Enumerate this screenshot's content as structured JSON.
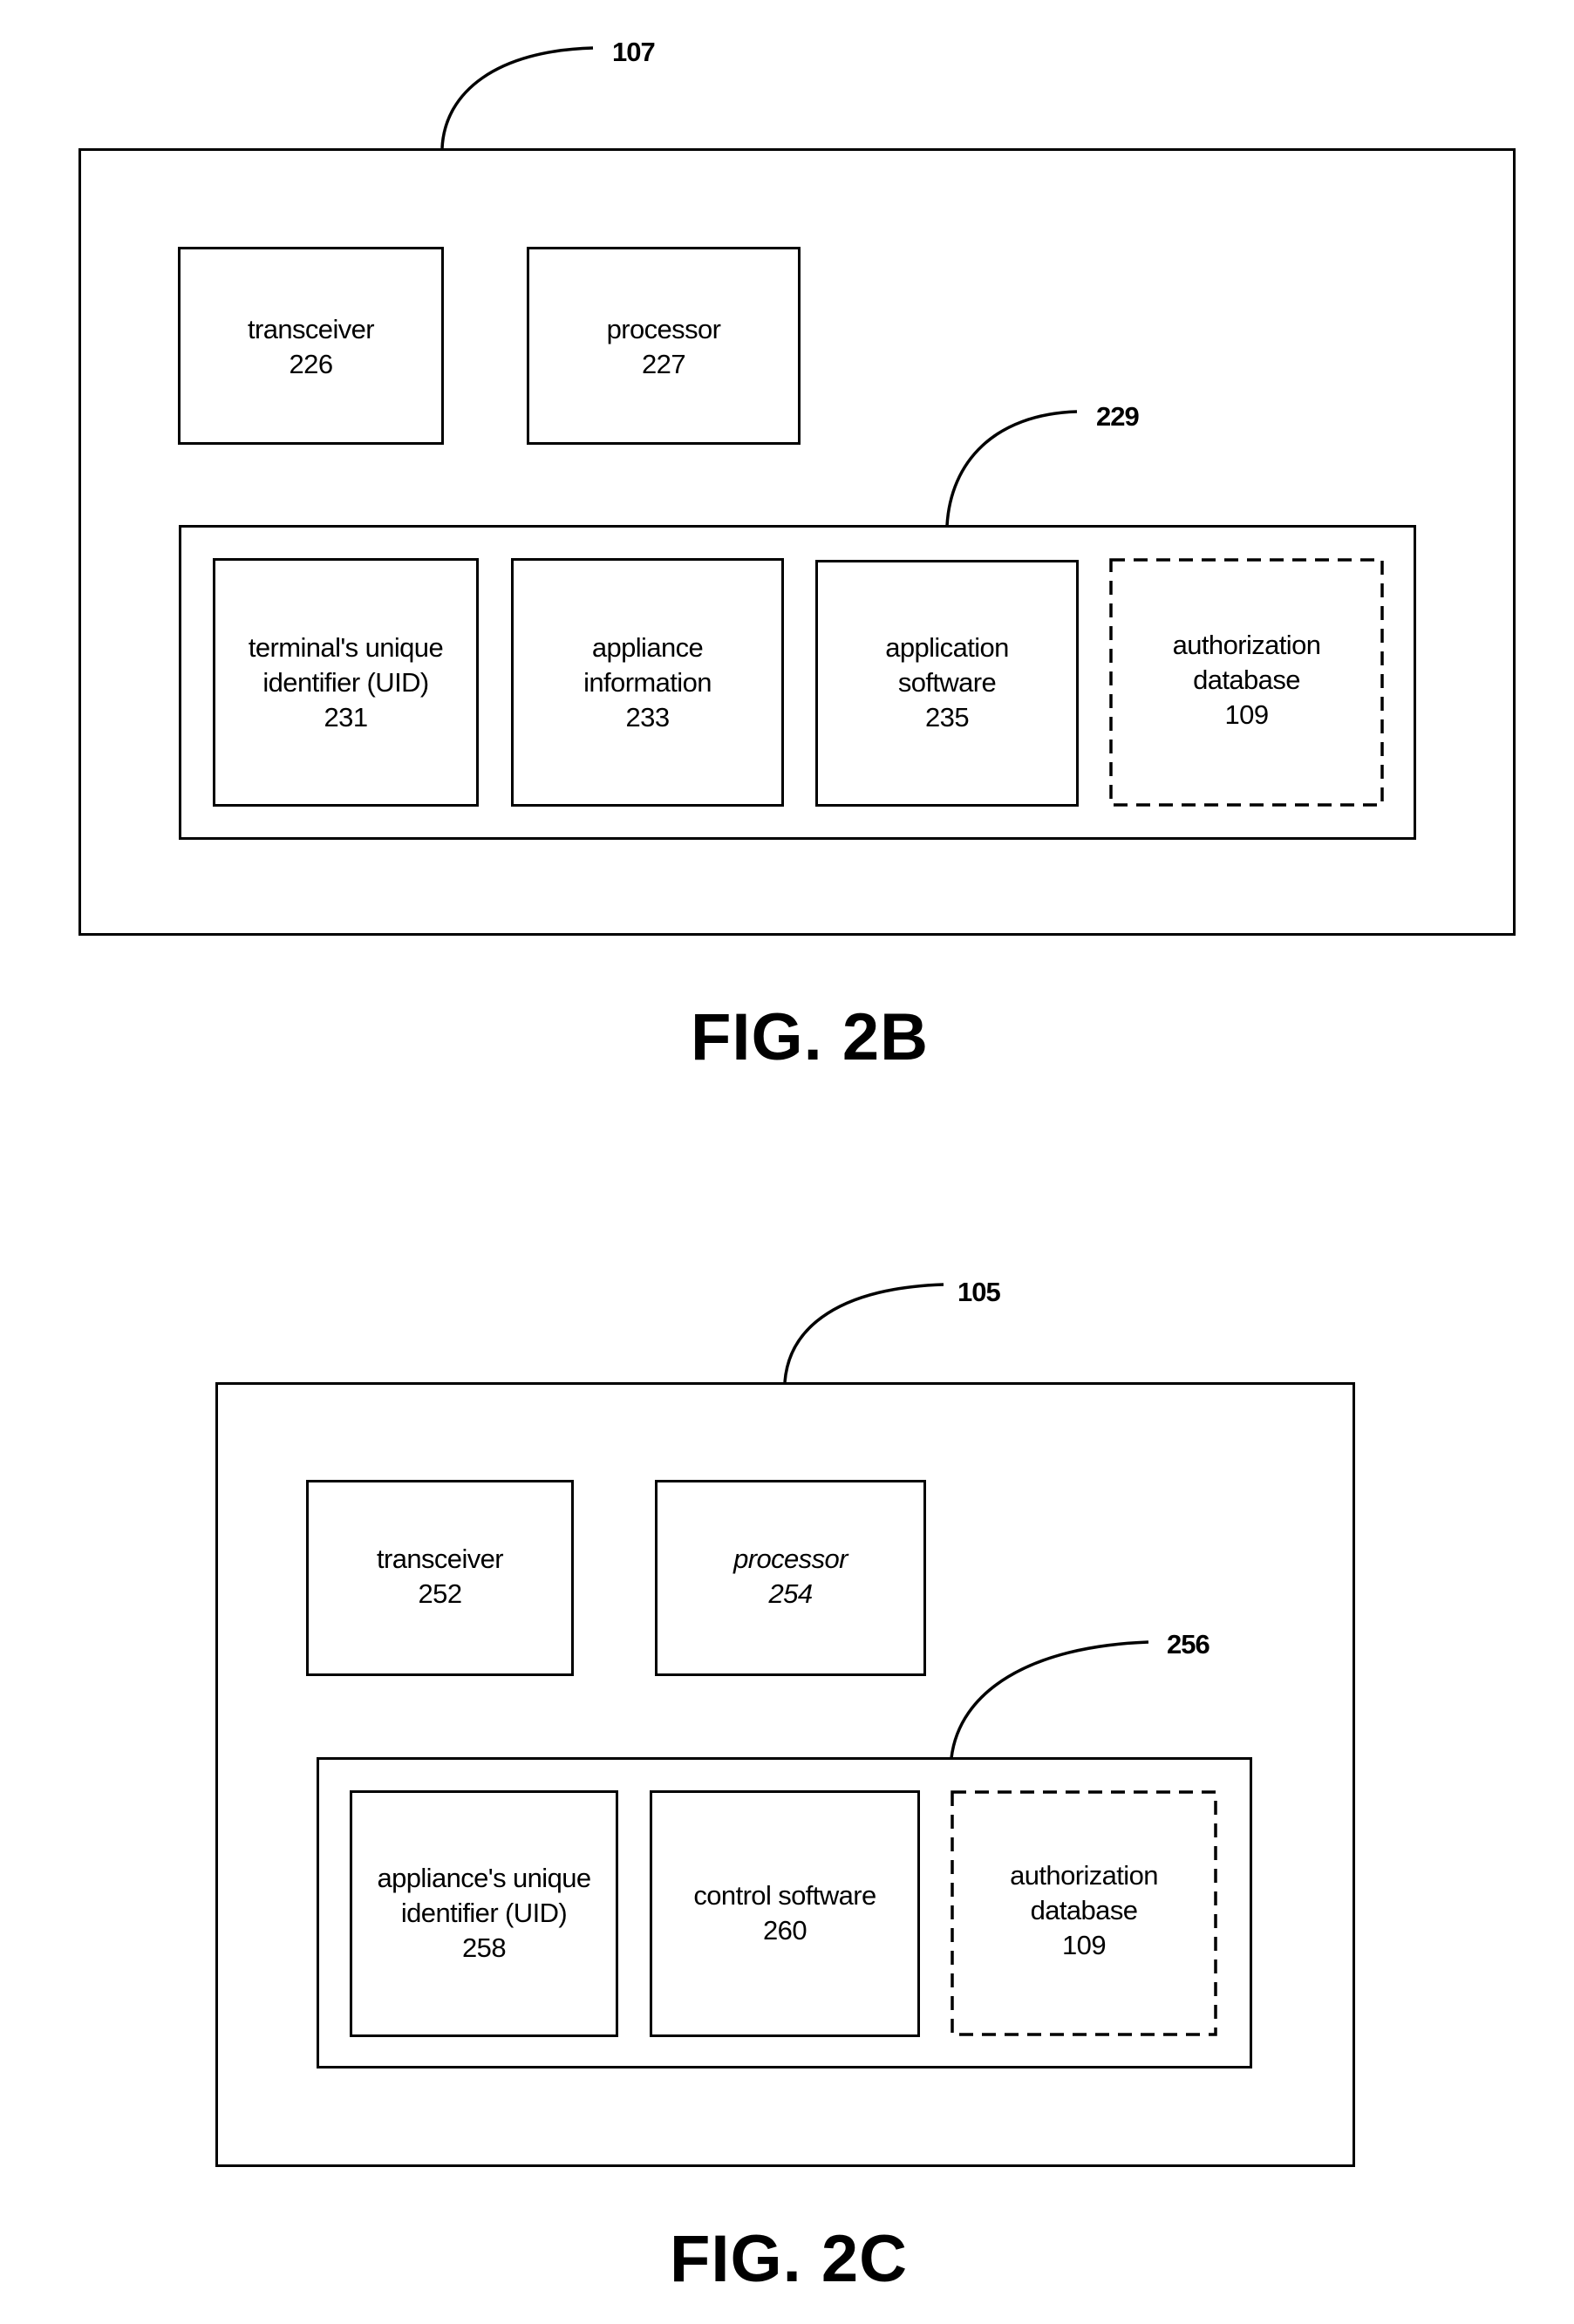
{
  "figures": [
    {
      "caption": "FIG. 2B",
      "device_ref": "107",
      "top_row": [
        {
          "line1": "transceiver",
          "line2": "",
          "ref": "226"
        },
        {
          "line1": "processor",
          "line2": "",
          "ref": "227"
        }
      ],
      "memory_ref": "229",
      "memory_items": [
        {
          "line1": "terminal's unique",
          "line2": "identifier (UID)",
          "ref": "231",
          "optional": false
        },
        {
          "line1": "appliance",
          "line2": "information",
          "ref": "233",
          "optional": false
        },
        {
          "line1": "application",
          "line2": "software",
          "ref": "235",
          "optional": false
        },
        {
          "line1": "authorization",
          "line2": "database",
          "ref": "109",
          "optional": true
        }
      ]
    },
    {
      "caption": "FIG. 2C",
      "device_ref": "105",
      "top_row": [
        {
          "line1": "transceiver",
          "line2": "",
          "ref": "252"
        },
        {
          "line1": "processor",
          "line2": "",
          "ref": "254"
        }
      ],
      "memory_ref": "256",
      "memory_items": [
        {
          "line1": "appliance's unique",
          "line2": "identifier (UID)",
          "ref": "258",
          "optional": false
        },
        {
          "line1": "control software",
          "line2": "",
          "ref": "260",
          "optional": false
        },
        {
          "line1": "authorization",
          "line2": "database",
          "ref": "109",
          "optional": true
        }
      ]
    }
  ],
  "colors": {
    "line": "#000000",
    "background": "#ffffff"
  }
}
